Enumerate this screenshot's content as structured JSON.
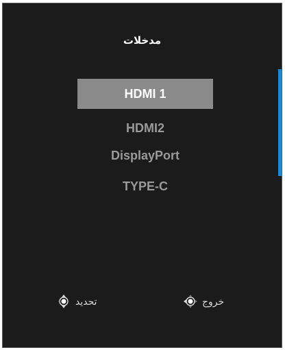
{
  "menu": {
    "title": "مدخلات",
    "items": [
      {
        "label": "HDMI 1",
        "selected": true
      },
      {
        "label": "HDMI2",
        "selected": false
      },
      {
        "label": "DisplayPort",
        "selected": false
      },
      {
        "label": "TYPE-C",
        "selected": false
      }
    ]
  },
  "hints": {
    "select_label": "تحديد",
    "exit_label": "خروج",
    "select_icon": "joystick-vertical-icon",
    "exit_icon": "joystick-left-icon"
  },
  "colors": {
    "background": "#1b1b1b",
    "selected_bg": "#8a8a8a",
    "scrollbar": "#1f88d4"
  }
}
